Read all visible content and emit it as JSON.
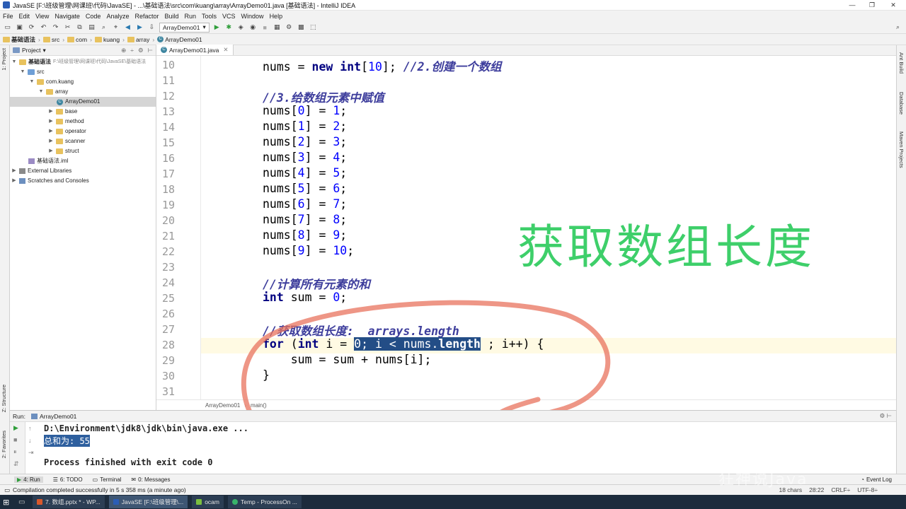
{
  "window": {
    "title": "JavaSE [F:\\班级管理\\网课班\\代码\\JavaSE] - ...\\基础语法\\src\\com\\kuang\\array\\ArrayDemo01.java [基础语法] - IntelliJ IDEA",
    "min": "—",
    "max": "❐",
    "close": "✕"
  },
  "menu": [
    "File",
    "Edit",
    "View",
    "Navigate",
    "Code",
    "Analyze",
    "Refactor",
    "Build",
    "Run",
    "Tools",
    "VCS",
    "Window",
    "Help"
  ],
  "toolbar": {
    "run_config": "ArrayDemo01"
  },
  "nav": [
    "基础语法",
    "src",
    "com",
    "kuang",
    "array",
    "ArrayDemo01"
  ],
  "left_strip": {
    "project": "1: Project",
    "structure": "Z: Structure",
    "favorites": "2: Favorites"
  },
  "right_strip": {
    "ant": "Ant Build",
    "database": "Database",
    "maven": "Maven Projects"
  },
  "project": {
    "title": "Project",
    "items": [
      {
        "label": "基础语法",
        "sub": "F:\\班级管理\\网课班\\代码\\JavaSE\\基础语法"
      },
      {
        "label": "src"
      },
      {
        "label": "com.kuang"
      },
      {
        "label": "array"
      },
      {
        "label": "ArrayDemo01"
      },
      {
        "label": "base"
      },
      {
        "label": "method"
      },
      {
        "label": "operator"
      },
      {
        "label": "scanner"
      },
      {
        "label": "struct"
      },
      {
        "label": "基础语法.iml"
      },
      {
        "label": "External Libraries"
      },
      {
        "label": "Scratches and Consoles"
      }
    ]
  },
  "editor": {
    "tab": "ArrayDemo01.java",
    "line_numbers": [
      "10",
      "11",
      "12",
      "13",
      "14",
      "15",
      "16",
      "17",
      "18",
      "19",
      "20",
      "21",
      "22",
      "23",
      "24",
      "25",
      "26",
      "27",
      "28",
      "29",
      "30",
      "31"
    ],
    "lines": {
      "l10a": "nums = ",
      "l10kw": "new int",
      "l10b": "[",
      "l10n": "10",
      "l10c": "]; ",
      "l10cmt": "//2.创建一个数组",
      "l12": "//3.给数组元素中赋值",
      "assign": [
        {
          "i": "0",
          "v": "1"
        },
        {
          "i": "1",
          "v": "2"
        },
        {
          "i": "2",
          "v": "3"
        },
        {
          "i": "3",
          "v": "4"
        },
        {
          "i": "4",
          "v": "5"
        },
        {
          "i": "5",
          "v": "6"
        },
        {
          "i": "6",
          "v": "7"
        },
        {
          "i": "7",
          "v": "8"
        },
        {
          "i": "8",
          "v": "9"
        },
        {
          "i": "9",
          "v": "10"
        }
      ],
      "l24": "//计算所有元素的和",
      "l25kw": "int",
      "l25a": " sum = ",
      "l25n": "0",
      "l25b": ";",
      "l27": "//获取数组长度:  arrays.length",
      "l28kw1": "for",
      "l28a": " (",
      "l28kw2": "int",
      "l28b": " i = ",
      "l28sel1": "0; i < nums.",
      "l28sel2": "length",
      "l28c": " ; i++) {",
      "l29": "    sum = sum + nums[i];",
      "l30": "}"
    },
    "breadcrumb": [
      "ArrayDemo01",
      "main()"
    ],
    "overlay_text": "获取数组长度"
  },
  "run": {
    "label": "Run:",
    "config": "ArrayDemo01",
    "output": [
      "D:\\Environment\\jdk8\\jdk\\bin\\java.exe ...",
      "总和为: 55",
      "",
      "Process finished with exit code 0"
    ]
  },
  "tool_windows": [
    "4: Run",
    "6: TODO",
    "Terminal",
    "0: Messages",
    "Event Log"
  ],
  "status": {
    "message": "Compilation completed successfully in 5 s 358 ms (a minute ago)",
    "chars": "18 chars",
    "pos": "28:22",
    "crlf": "CRLF÷",
    "enc": "UTF-8÷"
  },
  "taskbar": [
    "7. 数组.pptx * - WP...",
    "JavaSE [F:\\班级管理\\...",
    "ocam",
    "Temp - ProcessOn ..."
  ],
  "watermark": "狂神说Java"
}
